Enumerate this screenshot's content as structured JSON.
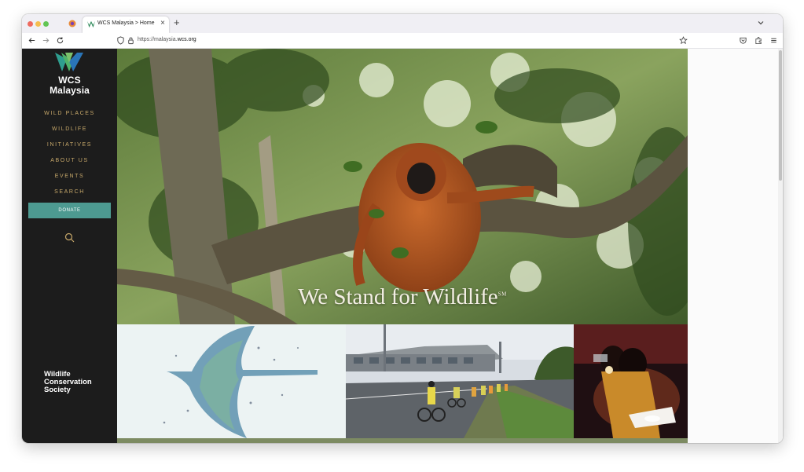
{
  "browser": {
    "tab_title": "WCS Malaysia > Home",
    "tab_close": "×",
    "new_tab": "+",
    "url_prefix": "https://malaysia.",
    "url_domain": "wcs.org",
    "icons": [
      "back-icon",
      "forward-icon",
      "reload-icon",
      "shield-icon",
      "lock-icon",
      "bookmark-star-icon",
      "pocket-icon",
      "extensions-icon",
      "menu-icon",
      "chevron-down-icon"
    ]
  },
  "sidebar": {
    "logo_line1": "WCS",
    "logo_line2": "Malaysia",
    "nav": [
      {
        "label": "WILD PLACES"
      },
      {
        "label": "WILDLIFE"
      },
      {
        "label": "INITIATIVES"
      },
      {
        "label": "ABOUT US"
      },
      {
        "label": "EVENTS"
      },
      {
        "label": "SEARCH"
      }
    ],
    "donate_label": "DONATE",
    "footer_line1": "Wildlife",
    "footer_line2": "Conservation",
    "footer_line3": "Society",
    "colors": {
      "nav": "#c7a86a",
      "donate": "#4d9a91",
      "background": "#1c1c1c"
    }
  },
  "hero": {
    "tagline": "We Stand for Wildlife",
    "tagline_mark": "SM"
  }
}
